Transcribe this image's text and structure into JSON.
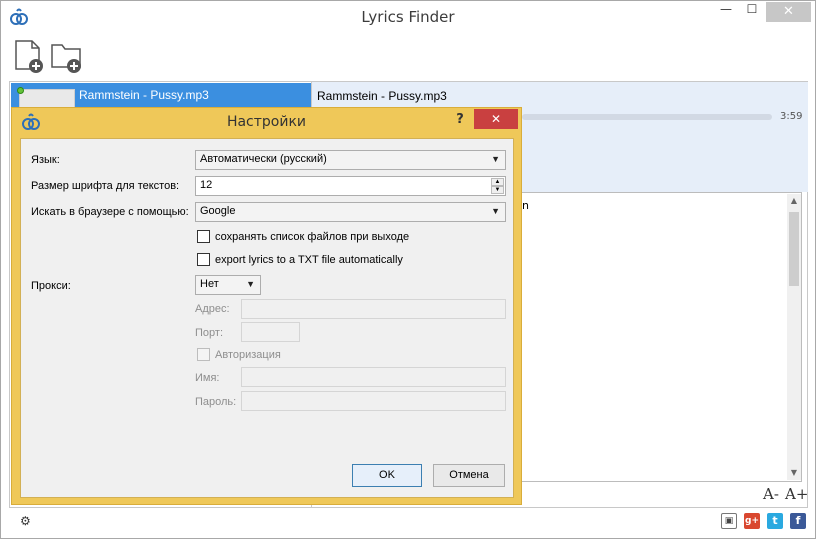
{
  "window": {
    "title": "Lyrics Finder",
    "minimize": "—",
    "maximize": "☐",
    "close": "✕"
  },
  "toolbar": {
    "add_file_icon": "add-file-icon",
    "add_folder_icon": "add-folder-icon"
  },
  "file_list": {
    "items": [
      {
        "title": "Rammstein - Pussy.mp3",
        "status_color": "#64c23a"
      }
    ]
  },
  "details": {
    "title": "Rammstein - Pussy.mp3",
    "duration": "3:59",
    "lyrics_visible_fragment": "n",
    "font_decrease": "A-",
    "font_increase": "A+"
  },
  "dialog": {
    "title": "Настройки",
    "help": "?",
    "close": "✕",
    "language_label": "Язык:",
    "language_value": "Автоматически (русский)",
    "font_size_label": "Размер шрифта для текстов:",
    "font_size_value": "12",
    "search_label": "Искать в браузере с помощью:",
    "search_value": "Google",
    "save_list_label": "сохранять список файлов при выходе",
    "export_txt_label": "export lyrics to a TXT file automatically",
    "proxy_label": "Прокси:",
    "proxy_value": "Нет",
    "address_label": "Адрес:",
    "port_label": "Порт:",
    "auth_label": "Авторизация",
    "name_label": "Имя:",
    "password_label": "Пароль:",
    "ok_label": "OK",
    "cancel_label": "Отмена"
  },
  "colors": {
    "dialog_frame": "#efc859",
    "selection": "#3b8fe0",
    "close_button": "#c94040"
  }
}
